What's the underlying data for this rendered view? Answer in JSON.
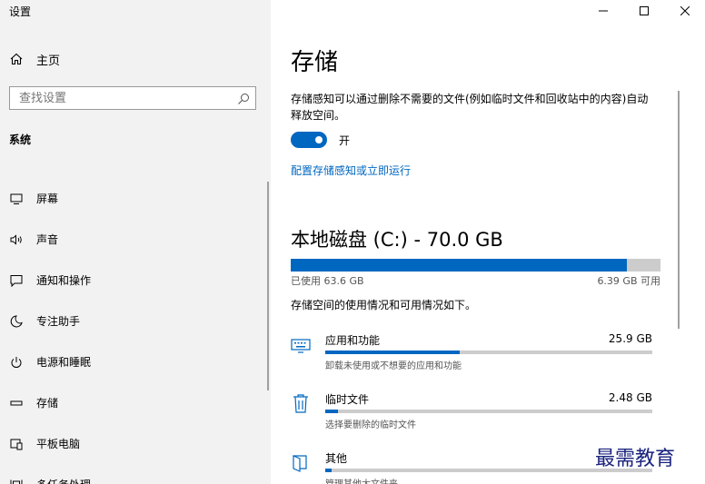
{
  "app": {
    "title": "设置"
  },
  "window_controls": {
    "minimize": "—",
    "maximize": "☐",
    "close": "✕"
  },
  "sidebar": {
    "home": {
      "label": "主页",
      "icon": "home-icon"
    },
    "search": {
      "placeholder": "查找设置",
      "icon": "search-icon"
    },
    "section_title": "系统",
    "items": [
      {
        "label": "屏幕",
        "icon": "monitor-icon"
      },
      {
        "label": "声音",
        "icon": "speaker-icon"
      },
      {
        "label": "通知和操作",
        "icon": "notification-icon"
      },
      {
        "label": "专注助手",
        "icon": "moon-icon"
      },
      {
        "label": "电源和睡眠",
        "icon": "power-icon"
      },
      {
        "label": "存储",
        "icon": "storage-icon"
      },
      {
        "label": "平板电脑",
        "icon": "tablet-icon"
      },
      {
        "label": "多任务处理",
        "icon": "multitask-icon"
      }
    ]
  },
  "main": {
    "title": "存储",
    "description": "存储感知可以通过删除不需要的文件(例如临时文件和回收站中的内容)自动释放空间。",
    "toggle": {
      "state": "on",
      "label": "开"
    },
    "configure_link": "配置存储感知或立即运行",
    "disk": {
      "title": "本地磁盘 (C:) - 70.0 GB",
      "used_label": "已使用 63.6 GB",
      "free_label": "6.39 GB 可用",
      "used_fraction": 0.909
    },
    "usage_info": "存储空间的使用情况和可用情况如下。",
    "categories": [
      {
        "name": "应用和功能",
        "size": "25.9 GB",
        "sub": "卸载未使用或不想要的应用和功能",
        "fraction": 0.41,
        "icon": "keyboard-icon"
      },
      {
        "name": "临时文件",
        "size": "2.48 GB",
        "sub": "选择要删除的临时文件",
        "fraction": 0.04,
        "icon": "trash-icon"
      },
      {
        "name": "其他",
        "size": "",
        "sub": "管理其他大文件夹",
        "fraction": 0.02,
        "icon": "folder-icon"
      }
    ]
  },
  "colors": {
    "accent": "#0067c0",
    "sidebar_bg": "#f2f2f2",
    "track": "#cccccc"
  },
  "watermark": "最需教育"
}
